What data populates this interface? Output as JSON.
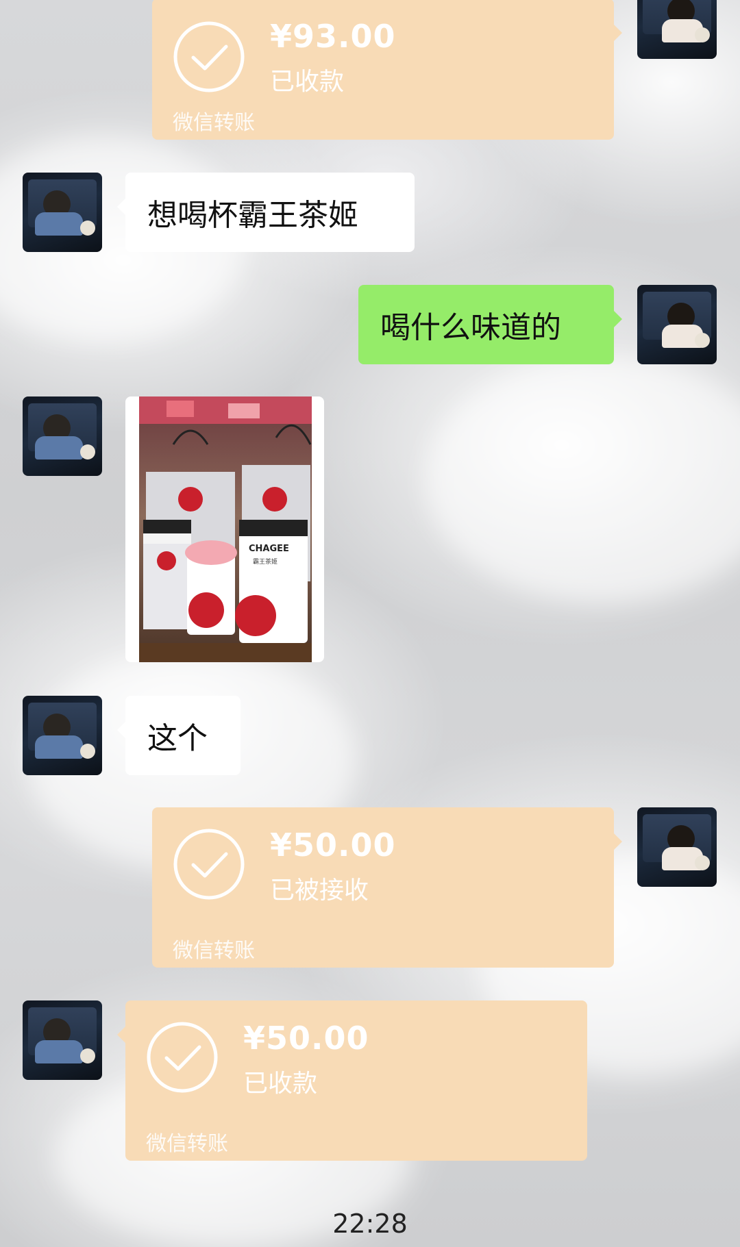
{
  "chat": {
    "messages": [
      {
        "type": "transfer",
        "side": "right",
        "amount": "¥93.00",
        "status": "已收款",
        "footer": "微信转账"
      },
      {
        "type": "text",
        "side": "left",
        "text": "想喝杯霸王茶姬"
      },
      {
        "type": "text",
        "side": "right",
        "text": "喝什么味道的"
      },
      {
        "type": "image",
        "side": "left",
        "image_label": "CHAGEE",
        "image_sub": "霸王茶姬"
      },
      {
        "type": "text",
        "side": "left",
        "text": "这个"
      },
      {
        "type": "transfer",
        "side": "right",
        "amount": "¥50.00",
        "status": "已被接收",
        "footer": "微信转账"
      },
      {
        "type": "transfer",
        "side": "left",
        "amount": "¥50.00",
        "status": "已收款",
        "footer": "微信转账"
      }
    ],
    "timestamp": "22:28"
  },
  "colors": {
    "transfer_bg": "#f8dbb6",
    "sent_bubble": "#95ec69",
    "received_bubble": "#ffffff"
  }
}
